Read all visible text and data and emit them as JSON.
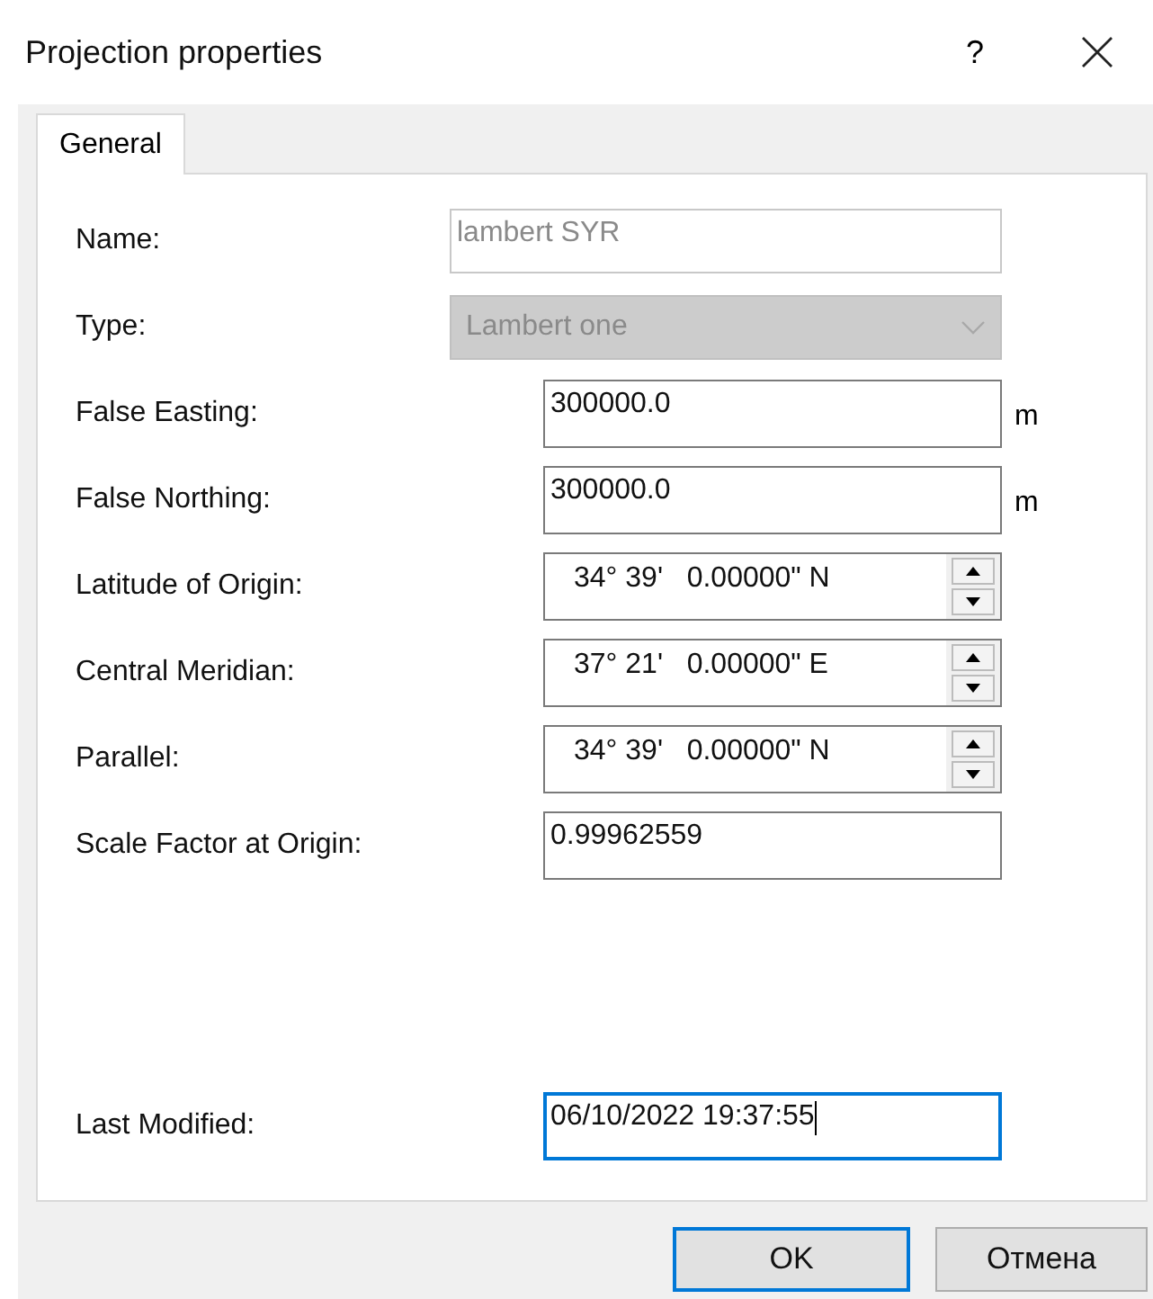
{
  "window": {
    "title": "Projection properties",
    "help": "?"
  },
  "tabs": [
    {
      "label": "General",
      "selected": true
    }
  ],
  "fields": [
    {
      "kind": "text",
      "label": "Name:",
      "value": "lambert SYR",
      "disabled": true,
      "focused": false
    },
    {
      "kind": "combo",
      "label": "Type:",
      "value": "Lambert one",
      "disabled": true,
      "focused": false
    },
    {
      "kind": "number",
      "label": "False Easting:",
      "value": "300000.0",
      "unit": "m",
      "disabled": false,
      "focused": false
    },
    {
      "kind": "number",
      "label": "False Northing:",
      "value": "300000.0",
      "unit": "m",
      "disabled": false,
      "focused": false
    },
    {
      "kind": "angle",
      "label": "Latitude of Origin:",
      "value": "34° 39'   0.00000\" N",
      "disabled": false,
      "focused": false
    },
    {
      "kind": "angle",
      "label": "Central Meridian:",
      "value": "37° 21'   0.00000\" E",
      "disabled": false,
      "focused": false
    },
    {
      "kind": "angle",
      "label": "Parallel:",
      "value": "34° 39'   0.00000\" N",
      "disabled": false,
      "focused": false
    },
    {
      "kind": "number",
      "label": "Scale Factor at Origin:",
      "value": "0.99962559",
      "disabled": false,
      "focused": false
    },
    {
      "kind": "spacer"
    },
    {
      "kind": "number",
      "label": "Last Modified:",
      "value": "06/10/2022 19:37:55",
      "disabled": false,
      "focused": true
    }
  ],
  "buttons": [
    {
      "label": "OK",
      "default": true
    },
    {
      "label": "Отмена",
      "default": false
    }
  ]
}
